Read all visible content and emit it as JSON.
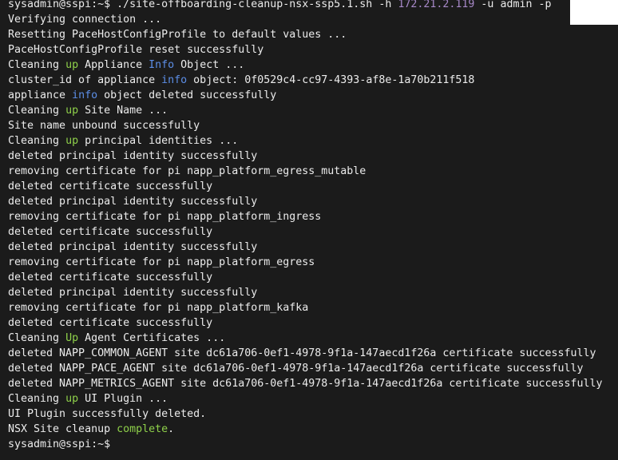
{
  "terminal": {
    "background": "#1b1b1b",
    "colors": {
      "white": "#ececec",
      "green": "#8fd14a",
      "blue": "#5c8ee6",
      "purple": "#a889c9"
    },
    "lines": [
      [
        {
          "t": "sysadmin@sspi:~$ ./site-offboarding-cleanup-nsx-ssp5.1.sh -h ",
          "c": "white"
        },
        {
          "t": "172.21.2.119",
          "c": "purple"
        },
        {
          "t": " -u admin -p",
          "c": "white"
        }
      ],
      [
        {
          "t": "Verifying connection ...",
          "c": "white"
        }
      ],
      [
        {
          "t": "Resetting PaceHostConfigProfile to default values ...",
          "c": "white"
        }
      ],
      [
        {
          "t": "PaceHostConfigProfile reset successfully",
          "c": "white"
        }
      ],
      [
        {
          "t": "Cleaning ",
          "c": "white"
        },
        {
          "t": "up",
          "c": "green"
        },
        {
          "t": " Appliance ",
          "c": "white"
        },
        {
          "t": "Info",
          "c": "blue"
        },
        {
          "t": " Object ...",
          "c": "white"
        }
      ],
      [
        {
          "t": "cluster_id of appliance ",
          "c": "white"
        },
        {
          "t": "info",
          "c": "blue"
        },
        {
          "t": " object: 0f0529c4-cc97-4393-af8e-1a70b211f518",
          "c": "white"
        }
      ],
      [
        {
          "t": "appliance ",
          "c": "white"
        },
        {
          "t": "info",
          "c": "blue"
        },
        {
          "t": " object deleted successfully",
          "c": "white"
        }
      ],
      [
        {
          "t": "Cleaning ",
          "c": "white"
        },
        {
          "t": "up",
          "c": "green"
        },
        {
          "t": " Site Name ...",
          "c": "white"
        }
      ],
      [
        {
          "t": "Site name unbound successfully",
          "c": "white"
        }
      ],
      [
        {
          "t": "Cleaning ",
          "c": "white"
        },
        {
          "t": "up",
          "c": "green"
        },
        {
          "t": " principal identities ...",
          "c": "white"
        }
      ],
      [
        {
          "t": "deleted principal identity successfully",
          "c": "white"
        }
      ],
      [
        {
          "t": "removing certificate for pi napp_platform_egress_mutable",
          "c": "white"
        }
      ],
      [
        {
          "t": "deleted certificate successfully",
          "c": "white"
        }
      ],
      [
        {
          "t": "deleted principal identity successfully",
          "c": "white"
        }
      ],
      [
        {
          "t": "removing certificate for pi napp_platform_ingress",
          "c": "white"
        }
      ],
      [
        {
          "t": "deleted certificate successfully",
          "c": "white"
        }
      ],
      [
        {
          "t": "deleted principal identity successfully",
          "c": "white"
        }
      ],
      [
        {
          "t": "removing certificate for pi napp_platform_egress",
          "c": "white"
        }
      ],
      [
        {
          "t": "deleted certificate successfully",
          "c": "white"
        }
      ],
      [
        {
          "t": "deleted principal identity successfully",
          "c": "white"
        }
      ],
      [
        {
          "t": "removing certificate for pi napp_platform_kafka",
          "c": "white"
        }
      ],
      [
        {
          "t": "deleted certificate successfully",
          "c": "white"
        }
      ],
      [
        {
          "t": "Cleaning ",
          "c": "white"
        },
        {
          "t": "Up",
          "c": "green"
        },
        {
          "t": " Agent Certificates ...",
          "c": "white"
        }
      ],
      [
        {
          "t": "deleted NAPP_COMMON_AGENT site dc61a706-0ef1-4978-9f1a-147aecd1f26a certificate successfully",
          "c": "white"
        }
      ],
      [
        {
          "t": "deleted NAPP_PACE_AGENT site dc61a706-0ef1-4978-9f1a-147aecd1f26a certificate successfully",
          "c": "white"
        }
      ],
      [
        {
          "t": "deleted NAPP_METRICS_AGENT site dc61a706-0ef1-4978-9f1a-147aecd1f26a certificate successfully",
          "c": "white"
        }
      ],
      [
        {
          "t": "Cleaning ",
          "c": "white"
        },
        {
          "t": "up",
          "c": "green"
        },
        {
          "t": " UI Plugin ...",
          "c": "white"
        }
      ],
      [
        {
          "t": "UI Plugin successfully deleted.",
          "c": "white"
        }
      ],
      [
        {
          "t": "NSX Site cleanup ",
          "c": "white"
        },
        {
          "t": "complete",
          "c": "green"
        },
        {
          "t": ".",
          "c": "white"
        }
      ],
      [
        {
          "t": "sysadmin@sspi:~$",
          "c": "white"
        }
      ]
    ]
  }
}
